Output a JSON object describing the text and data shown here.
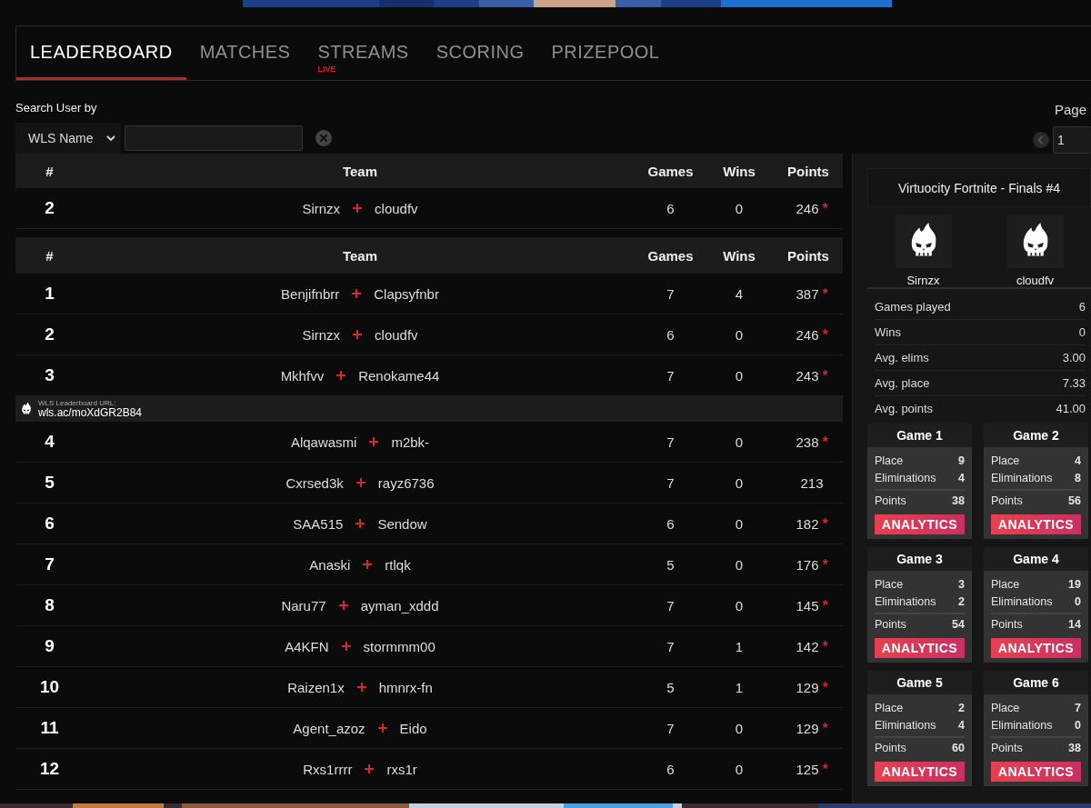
{
  "tabs": [
    {
      "label": "LEADERBOARD",
      "selected": true
    },
    {
      "label": "MATCHES",
      "selected": false
    },
    {
      "label": "STREAMS",
      "selected": false,
      "badge": "LIVE"
    },
    {
      "label": "SCORING",
      "selected": false
    },
    {
      "label": "PRIZEPOOL",
      "selected": false
    }
  ],
  "search": {
    "label": "Search User by",
    "filter": "WLS Name"
  },
  "pager": {
    "label": "Page",
    "value": "1"
  },
  "user_table": {
    "columns": [
      "#",
      "Team",
      "Games",
      "Wins",
      "Points"
    ],
    "rows": [
      {
        "kind": "team",
        "rank": "2",
        "players": [
          "Sirnzx",
          "cloudfv"
        ],
        "games": "6",
        "wins": "0",
        "points": "246",
        "marked": true
      }
    ]
  },
  "table": {
    "columns": [
      "#",
      "Team",
      "Games",
      "Wins",
      "Points"
    ],
    "rows": [
      {
        "kind": "team",
        "rank": "1",
        "players": [
          "Benjifnbrr",
          "Clapsyfnbr"
        ],
        "games": "7",
        "wins": "4",
        "points": "387",
        "marked": true
      },
      {
        "kind": "team",
        "rank": "2",
        "players": [
          "Sirnzx",
          "cloudfv"
        ],
        "games": "6",
        "wins": "0",
        "points": "246",
        "marked": true
      },
      {
        "kind": "team",
        "rank": "3",
        "players": [
          "Mkhfvv",
          "Renokame44"
        ],
        "games": "7",
        "wins": "0",
        "points": "243",
        "marked": true
      },
      {
        "kind": "banner",
        "label": "WLS Leaderboard URL:",
        "url": "wls.ac/moXdGR2B84"
      },
      {
        "kind": "team",
        "rank": "4",
        "players": [
          "Alqawasmi",
          "m2bk-"
        ],
        "games": "7",
        "wins": "0",
        "points": "238",
        "marked": true
      },
      {
        "kind": "team",
        "rank": "5",
        "players": [
          "Cxrsed3k",
          "rayz6736"
        ],
        "games": "7",
        "wins": "0",
        "points": "213",
        "marked": false
      },
      {
        "kind": "team",
        "rank": "6",
        "players": [
          "SAA515",
          "Sendow"
        ],
        "games": "6",
        "wins": "0",
        "points": "182",
        "marked": true
      },
      {
        "kind": "team",
        "rank": "7",
        "players": [
          "Anaski",
          "rtlqk"
        ],
        "games": "5",
        "wins": "0",
        "points": "176",
        "marked": true
      },
      {
        "kind": "team",
        "rank": "8",
        "players": [
          "Naru77",
          "ayman_xddd"
        ],
        "games": "7",
        "wins": "0",
        "points": "145",
        "marked": true
      },
      {
        "kind": "team",
        "rank": "9",
        "players": [
          "A4KFN",
          "stormmm00"
        ],
        "games": "7",
        "wins": "1",
        "points": "142",
        "marked": true
      },
      {
        "kind": "team",
        "rank": "10",
        "players": [
          "Raizen1x",
          "hmnrx-fn"
        ],
        "games": "5",
        "wins": "1",
        "points": "129",
        "marked": true
      },
      {
        "kind": "team",
        "rank": "11",
        "players": [
          "Agent_azoz",
          "Eido"
        ],
        "games": "7",
        "wins": "0",
        "points": "129",
        "marked": true
      },
      {
        "kind": "team",
        "rank": "12",
        "players": [
          "Rxs1rrrr",
          "rxs1r"
        ],
        "games": "6",
        "wins": "0",
        "points": "125",
        "marked": true
      }
    ]
  },
  "side": {
    "title": "Virtuocity Fortnite - Finals #4",
    "players": [
      "Sirnzx",
      "cloudfv"
    ],
    "stats": [
      {
        "label": "Games played",
        "value": "6"
      },
      {
        "label": "Wins",
        "value": "0"
      },
      {
        "label": "Avg. elims",
        "value": "3.00"
      },
      {
        "label": "Avg. place",
        "value": "7.33"
      },
      {
        "label": "Avg. points",
        "value": "41.00"
      }
    ],
    "games": [
      {
        "title": "Game 1",
        "stats": [
          {
            "label": "Place",
            "value": "9"
          },
          {
            "label": "Eliminations",
            "value": "4"
          },
          {
            "label": "Points",
            "value": "38"
          }
        ],
        "button": "ANALYTICS"
      },
      {
        "title": "Game 2",
        "stats": [
          {
            "label": "Place",
            "value": "4"
          },
          {
            "label": "Eliminations",
            "value": "8"
          },
          {
            "label": "Points",
            "value": "56"
          }
        ],
        "button": "ANALYTICS"
      },
      {
        "title": "Game 3",
        "stats": [
          {
            "label": "Place",
            "value": "3"
          },
          {
            "label": "Eliminations",
            "value": "2"
          },
          {
            "label": "Points",
            "value": "54"
          }
        ],
        "button": "ANALYTICS"
      },
      {
        "title": "Game 4",
        "stats": [
          {
            "label": "Place",
            "value": "19"
          },
          {
            "label": "Eliminations",
            "value": "0"
          },
          {
            "label": "Points",
            "value": "14"
          }
        ],
        "button": "ANALYTICS"
      },
      {
        "title": "Game 5",
        "stats": [
          {
            "label": "Place",
            "value": "2"
          },
          {
            "label": "Eliminations",
            "value": "4"
          },
          {
            "label": "Points",
            "value": "60"
          }
        ],
        "button": "ANALYTICS"
      },
      {
        "title": "Game 6",
        "stats": [
          {
            "label": "Place",
            "value": "7"
          },
          {
            "label": "Eliminations",
            "value": "0"
          },
          {
            "label": "Points",
            "value": "38"
          }
        ],
        "button": "ANALYTICS"
      }
    ]
  }
}
